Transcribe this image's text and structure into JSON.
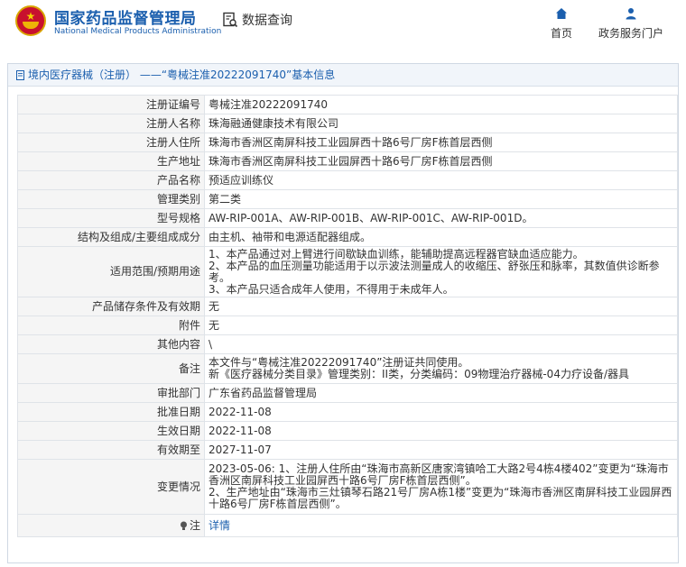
{
  "site": {
    "title": "国家药品监督管理局",
    "subtitle": "National Medical Products Administration"
  },
  "header": {
    "query_label": "数据查询",
    "nav": [
      {
        "label": "首页"
      },
      {
        "label": "政务服务门户"
      }
    ]
  },
  "panel": {
    "title": "境内医疗器械（注册） ——“粤械注准20222091740”基本信息"
  },
  "rows": [
    {
      "label": "注册证编号",
      "value": "粤械注准20222091740"
    },
    {
      "label": "注册人名称",
      "value": "珠海融通健康技术有限公司"
    },
    {
      "label": "注册人住所",
      "value": "珠海市香洲区南屏科技工业园屏西十路6号厂房F栋首层西侧"
    },
    {
      "label": "生产地址",
      "value": "珠海市香洲区南屏科技工业园屏西十路6号厂房F栋首层西侧"
    },
    {
      "label": "产品名称",
      "value": "预适应训练仪"
    },
    {
      "label": "管理类别",
      "value": "第二类"
    },
    {
      "label": "型号规格",
      "value": "AW-RIP-001A、AW-RIP-001B、AW-RIP-001C、AW-RIP-001D。"
    },
    {
      "label": "结构及组成/主要组成成分",
      "value": "由主机、袖带和电源适配器组成。"
    },
    {
      "label": "适用范围/预期用途",
      "value": "1、本产品通过对上臂进行间歇缺血训练，能辅助提高远程器官缺血适应能力。\n2、本产品的血压测量功能适用于以示波法测量成人的收缩压、舒张压和脉率，其数值供诊断参考。\n3、本产品只适合成年人使用，不得用于未成年人。"
    },
    {
      "label": "产品储存条件及有效期",
      "value": "无"
    },
    {
      "label": "附件",
      "value": "无"
    },
    {
      "label": "其他内容",
      "value": "\\"
    },
    {
      "label": "备注",
      "value": "本文件与“粤械注准20222091740”注册证共同使用。\n新《医疗器械分类目录》管理类别：II类，分类编码：09物理治疗器械-04力疗设备/器具"
    },
    {
      "label": "审批部门",
      "value": "广东省药品监督管理局"
    },
    {
      "label": "批准日期",
      "value": "2022-11-08"
    },
    {
      "label": "生效日期",
      "value": "2022-11-08"
    },
    {
      "label": "有效期至",
      "value": "2027-11-07"
    },
    {
      "label": "变更情况",
      "value": "2023-05-06: 1、注册人住所由“珠海市高新区唐家湾镇哈工大路2号4栋4楼402”变更为“珠海市香洲区南屏科技工业园屏西十路6号厂房F栋首层西侧”。\n2、生产地址由“珠海市三灶镇琴石路21号厂房A栋1楼”变更为“珠海市香洲区南屏科技工业园屏西十路6号厂房F栋首层西侧”。"
    }
  ],
  "note": {
    "label": "注",
    "link_text": "详情"
  },
  "colors": {
    "brand_blue": "#1b5fae",
    "label_bg": "#f5f5f5",
    "border": "#dfe3e8"
  }
}
